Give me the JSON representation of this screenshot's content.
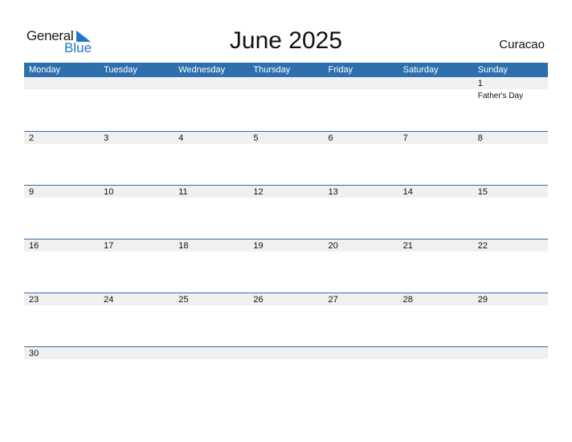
{
  "logo": {
    "line1": "General",
    "line2": "Blue"
  },
  "title": "June 2025",
  "country": "Curacao",
  "colors": {
    "header_bg": "#2e6fad",
    "accent": "#2176c7",
    "date_row_bg": "#f0f0f0"
  },
  "weekdays": [
    "Monday",
    "Tuesday",
    "Wednesday",
    "Thursday",
    "Friday",
    "Saturday",
    "Sunday"
  ],
  "weeks": [
    [
      {
        "d": ""
      },
      {
        "d": ""
      },
      {
        "d": ""
      },
      {
        "d": ""
      },
      {
        "d": ""
      },
      {
        "d": ""
      },
      {
        "d": "1",
        "event": "Father's Day"
      }
    ],
    [
      {
        "d": "2"
      },
      {
        "d": "3"
      },
      {
        "d": "4"
      },
      {
        "d": "5"
      },
      {
        "d": "6"
      },
      {
        "d": "7"
      },
      {
        "d": "8"
      }
    ],
    [
      {
        "d": "9"
      },
      {
        "d": "10"
      },
      {
        "d": "11"
      },
      {
        "d": "12"
      },
      {
        "d": "13"
      },
      {
        "d": "14"
      },
      {
        "d": "15"
      }
    ],
    [
      {
        "d": "16"
      },
      {
        "d": "17"
      },
      {
        "d": "18"
      },
      {
        "d": "19"
      },
      {
        "d": "20"
      },
      {
        "d": "21"
      },
      {
        "d": "22"
      }
    ],
    [
      {
        "d": "23"
      },
      {
        "d": "24"
      },
      {
        "d": "25"
      },
      {
        "d": "26"
      },
      {
        "d": "27"
      },
      {
        "d": "28"
      },
      {
        "d": "29"
      }
    ],
    [
      {
        "d": "30"
      },
      {
        "d": ""
      },
      {
        "d": ""
      },
      {
        "d": ""
      },
      {
        "d": ""
      },
      {
        "d": ""
      },
      {
        "d": ""
      }
    ]
  ]
}
